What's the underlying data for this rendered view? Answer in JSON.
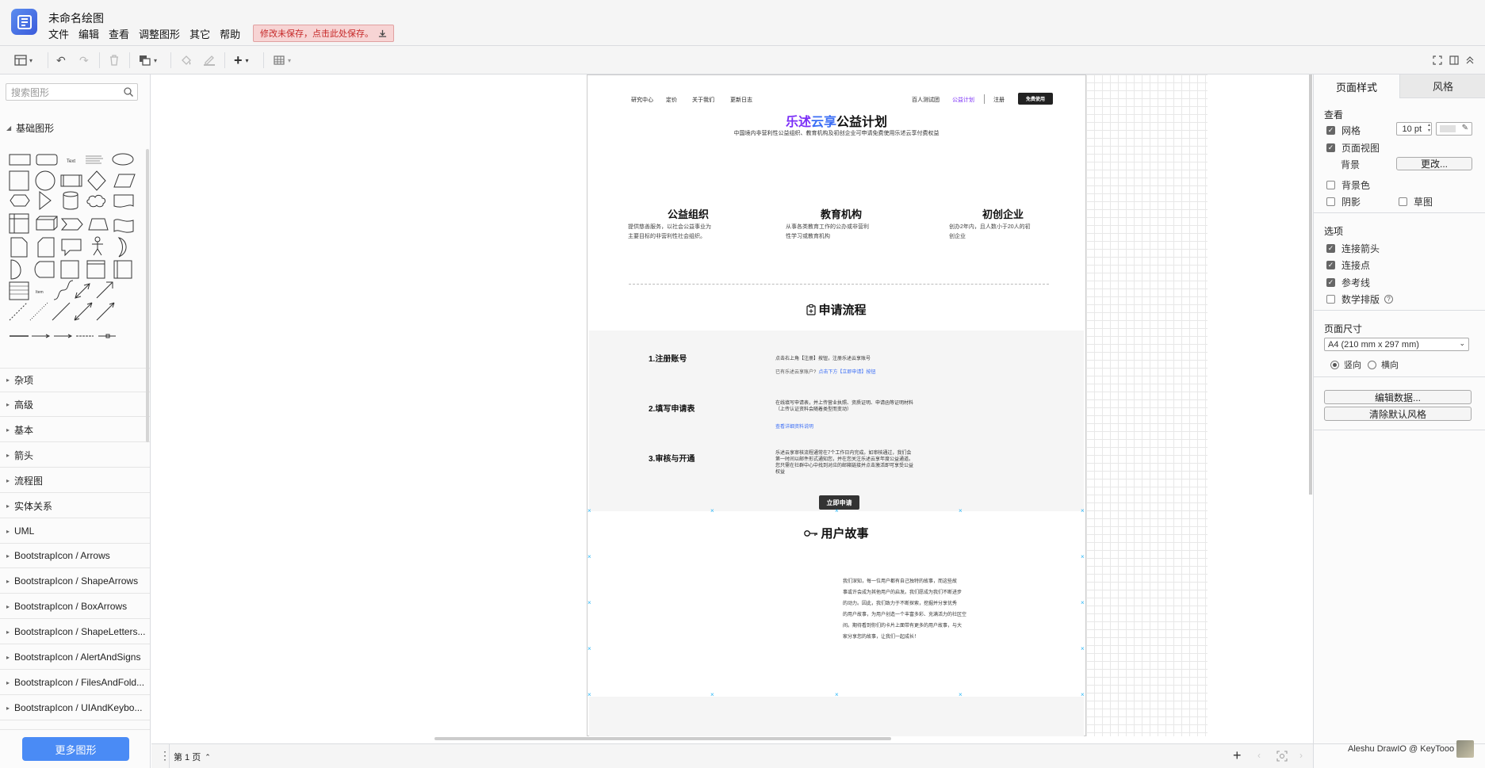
{
  "app": {
    "title": "未命名绘图",
    "menus": [
      "文件",
      "编辑",
      "查看",
      "调整图形",
      "其它",
      "帮助"
    ],
    "unsaved_notice": "修改未保存，点击此处保存。",
    "credit": "Aleshu DrawIO @ KeyTooo"
  },
  "sidebar": {
    "search_placeholder": "搜索图形",
    "open_category": "基础图形",
    "text_shape_label": "Text",
    "categories": [
      "杂项",
      "高级",
      "基本",
      "箭头",
      "流程图",
      "实体关系",
      "UML",
      "BootstrapIcon / Arrows",
      "BootstrapIcon / ShapeArrows",
      "BootstrapIcon / BoxArrows",
      "BootstrapIcon / ShapeLetters...",
      "BootstrapIcon / AlertAndSigns",
      "BootstrapIcon / FilesAndFold...",
      "BootstrapIcon / UIAndKeybo..."
    ],
    "more_shapes": "更多图形"
  },
  "bottom": {
    "page_tab": "第 1 页"
  },
  "right_panel": {
    "tabs": [
      "页面样式",
      "风格"
    ],
    "view_section": "查看",
    "grid": {
      "label": "网格",
      "checked": true,
      "size": "10 pt"
    },
    "page_view": {
      "label": "页面视图",
      "checked": true
    },
    "background": {
      "label": "背景",
      "button": "更改..."
    },
    "bg_color": {
      "label": "背景色",
      "checked": false
    },
    "shadow": {
      "label": "阴影",
      "checked": false
    },
    "sketch": {
      "label": "草图",
      "checked": false
    },
    "options_section": "选项",
    "options": [
      {
        "label": "连接箭头",
        "checked": true
      },
      {
        "label": "连接点",
        "checked": true
      },
      {
        "label": "参考线",
        "checked": true
      },
      {
        "label": "数学排版",
        "checked": false
      }
    ],
    "page_size_section": "页面尺寸",
    "page_size": "A4 (210 mm x 297 mm)",
    "orientation": {
      "portrait": "竖向",
      "landscape": "横向",
      "selected": "portrait"
    },
    "edit_data": "编辑数据...",
    "clear_style": "清除默认风格"
  },
  "diagram": {
    "nav_left": [
      "研究中心",
      "定价",
      "关于我们",
      "更新日志"
    ],
    "nav_right": [
      "百人测试团",
      "公益计划",
      "注册"
    ],
    "cta_nav": "免费使用",
    "title_part1": "乐述",
    "title_part2": "云享",
    "title_part3": "公益计划",
    "subtitle": "中国境内非营利性公益组织、教育机构及初创企业可申请免费使用乐述云享付费权益",
    "columns": [
      {
        "title": "公益组织",
        "line1": "提供慈善服务，以社会公益事业为",
        "line2": "主要目标的非营利性社会组织。"
      },
      {
        "title": "教育机构",
        "line1": "从事各类教育工作的公办或非营利",
        "line2": "性学习或教育机构"
      },
      {
        "title": "初创企业",
        "line1": "创办2年内，且人数小于20人的初",
        "line2": "创企业"
      }
    ],
    "process_title": "申请流程",
    "steps": [
      {
        "title": "1.注册账号",
        "text": "点击右上角【注册】按钮，注册乐述云享账号",
        "extra_prefix": "已有乐述云享账户?",
        "extra_link": "点击下方【立即申请】按钮"
      },
      {
        "title": "2.填写申请表",
        "text": "在线填写申请表，并上传营业执照、资质证明、申请函等证明材料（上传认证资料会随着类型而变动）",
        "extra_link": "查看详细资料说明"
      },
      {
        "title": "3.审核与开通",
        "text": "乐述云享审核流程通常在7个工作日内完成。如审核通过，我们会第一时间以邮件形式通知您，并在您关注乐述云享年度公益通道。您只需在社群中心中找到对应的邮箱链接并点击激活即可享受公益权益"
      }
    ],
    "apply_button": "立即申请",
    "story_title": "用户故事",
    "story_text": [
      "我们深知，每一位用户都有自己独特的故事，而这些故",
      "事或许会成为其他用户的启发。我们愿成为我们不断进步",
      "的动力。因此，我们致力于不断探索，挖掘并分享优秀",
      "的用户故事，为用户创造一个丰富多彩、充满活力的社区空",
      "间。期待看到你们的卡片上面带有更多的用户故事，与大",
      "家分享您的故事，让我们一起成长！"
    ]
  }
}
